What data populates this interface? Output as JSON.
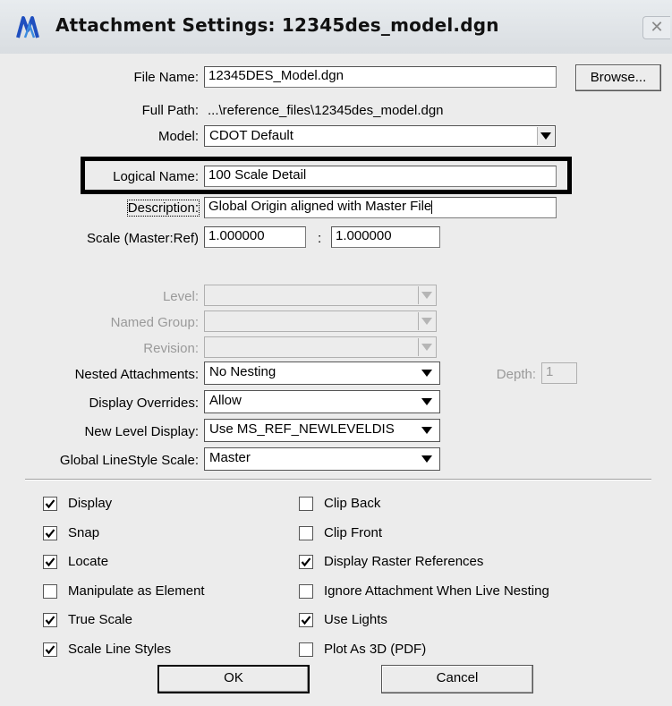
{
  "window": {
    "title": "Attachment Settings: 12345des_model.dgn",
    "close_glyph": "✕",
    "accent_color": "#1f4fbf"
  },
  "form": {
    "file_name_label": "File Name:",
    "file_name_value": "12345DES_Model.dgn",
    "browse_label": "Browse...",
    "full_path_label": "Full Path:",
    "full_path_value": "...\\reference_files\\12345des_model.dgn",
    "model_label": "Model:",
    "model_value": "CDOT Default",
    "logical_name_label": "Logical Name:",
    "logical_name_value": "100 Scale Detail",
    "description_label": "Description:",
    "description_value": "Global Origin aligned with Master File",
    "scale_label": "Scale (Master:Ref)",
    "scale_master": "1.000000",
    "scale_separator": ":",
    "scale_ref": "1.000000",
    "level_label": "Level:",
    "named_group_label": "Named Group:",
    "revision_label": "Revision:",
    "nested_label": "Nested Attachments:",
    "nested_value": "No Nesting",
    "depth_label": "Depth:",
    "depth_value": "1",
    "display_overrides_label": "Display Overrides:",
    "display_overrides_value": "Allow",
    "new_level_label": "New Level Display:",
    "new_level_value": "Use MS_REF_NEWLEVELDIS",
    "linestyle_label": "Global LineStyle Scale:",
    "linestyle_value": "Master"
  },
  "checkboxes_left": [
    {
      "label": "Display",
      "checked": true
    },
    {
      "label": "Snap",
      "checked": true
    },
    {
      "label": "Locate",
      "checked": true
    },
    {
      "label": "Manipulate as Element",
      "checked": false
    },
    {
      "label": "True Scale",
      "checked": true
    },
    {
      "label": "Scale Line Styles",
      "checked": true
    }
  ],
  "checkboxes_right": [
    {
      "label": "Clip Back",
      "checked": false
    },
    {
      "label": "Clip Front",
      "checked": false
    },
    {
      "label": "Display Raster References",
      "checked": true
    },
    {
      "label": "Ignore Attachment When Live Nesting",
      "checked": false
    },
    {
      "label": "Use Lights",
      "checked": true
    },
    {
      "label": "Plot As 3D (PDF)",
      "checked": false
    }
  ],
  "buttons": {
    "ok": "OK",
    "cancel": "Cancel"
  }
}
